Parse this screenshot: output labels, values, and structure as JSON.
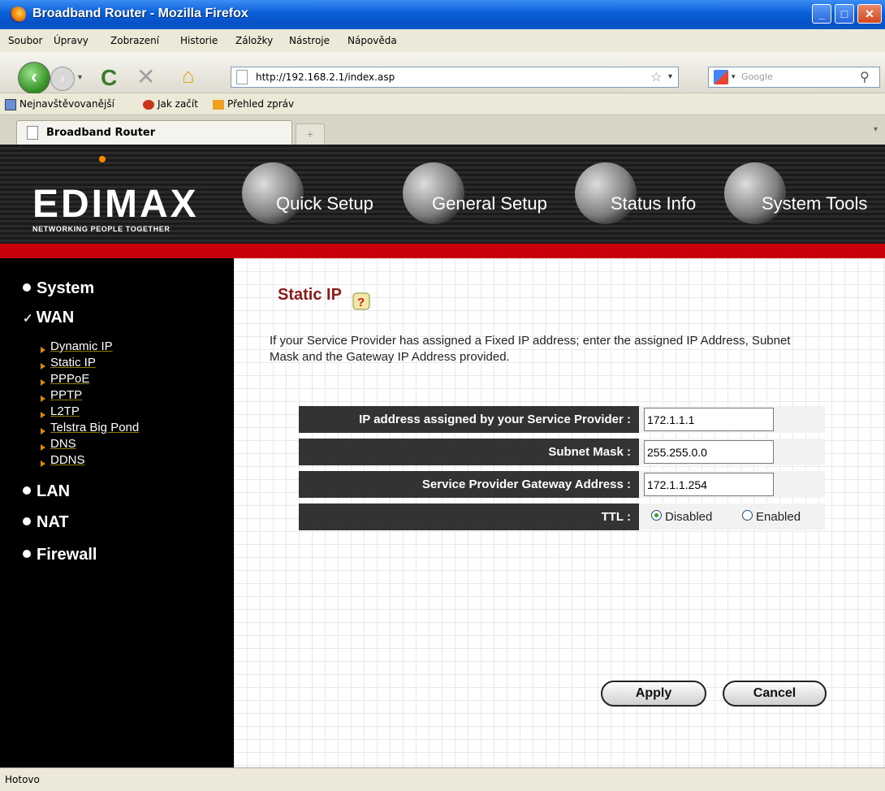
{
  "window": {
    "title": "Broadband Router - Mozilla Firefox"
  },
  "menu": [
    "Soubor",
    "Úpravy",
    "Zobrazení",
    "Historie",
    "Záložky",
    "Nástroje",
    "Nápověda"
  ],
  "toolbar": {
    "url": "http://192.168.2.1/index.asp",
    "search_placeholder": "Google"
  },
  "bookmarks": [
    "Nejnavštěvovanější",
    "Jak začít",
    "Přehled zpráv"
  ],
  "tabs": [
    {
      "label": "Broadband Router"
    }
  ],
  "header": {
    "logo": "EDIMAX",
    "tagline": "NETWORKING PEOPLE TOGETHER",
    "nav": [
      "Quick Setup",
      "General Setup",
      "Status Info",
      "System Tools"
    ]
  },
  "sidebar": {
    "system": "System",
    "wan": "WAN",
    "wan_items": [
      "Dynamic IP",
      "Static IP",
      "PPPoE",
      "PPTP",
      "L2TP",
      "Telstra Big Pond",
      "DNS",
      "DDNS"
    ],
    "lan": "LAN",
    "nat": "NAT",
    "firewall": "Firewall"
  },
  "main": {
    "title": "Static IP",
    "description": "If your Service Provider has assigned a Fixed IP address; enter the assigned IP Address, Subnet Mask and the Gateway IP Address provided.",
    "fields": [
      {
        "label": "IP address assigned by your Service Provider :",
        "value": "172.1.1.1"
      },
      {
        "label": "Subnet Mask :",
        "value": "255.255.0.0"
      },
      {
        "label": "Service Provider Gateway Address :",
        "value": "172.1.1.254"
      }
    ],
    "ttl": {
      "label": "TTL :",
      "option_disabled": "Disabled",
      "option_enabled": "Enabled",
      "selected": "Disabled"
    },
    "apply_label": "Apply",
    "cancel_label": "Cancel"
  },
  "status": "Hotovo"
}
